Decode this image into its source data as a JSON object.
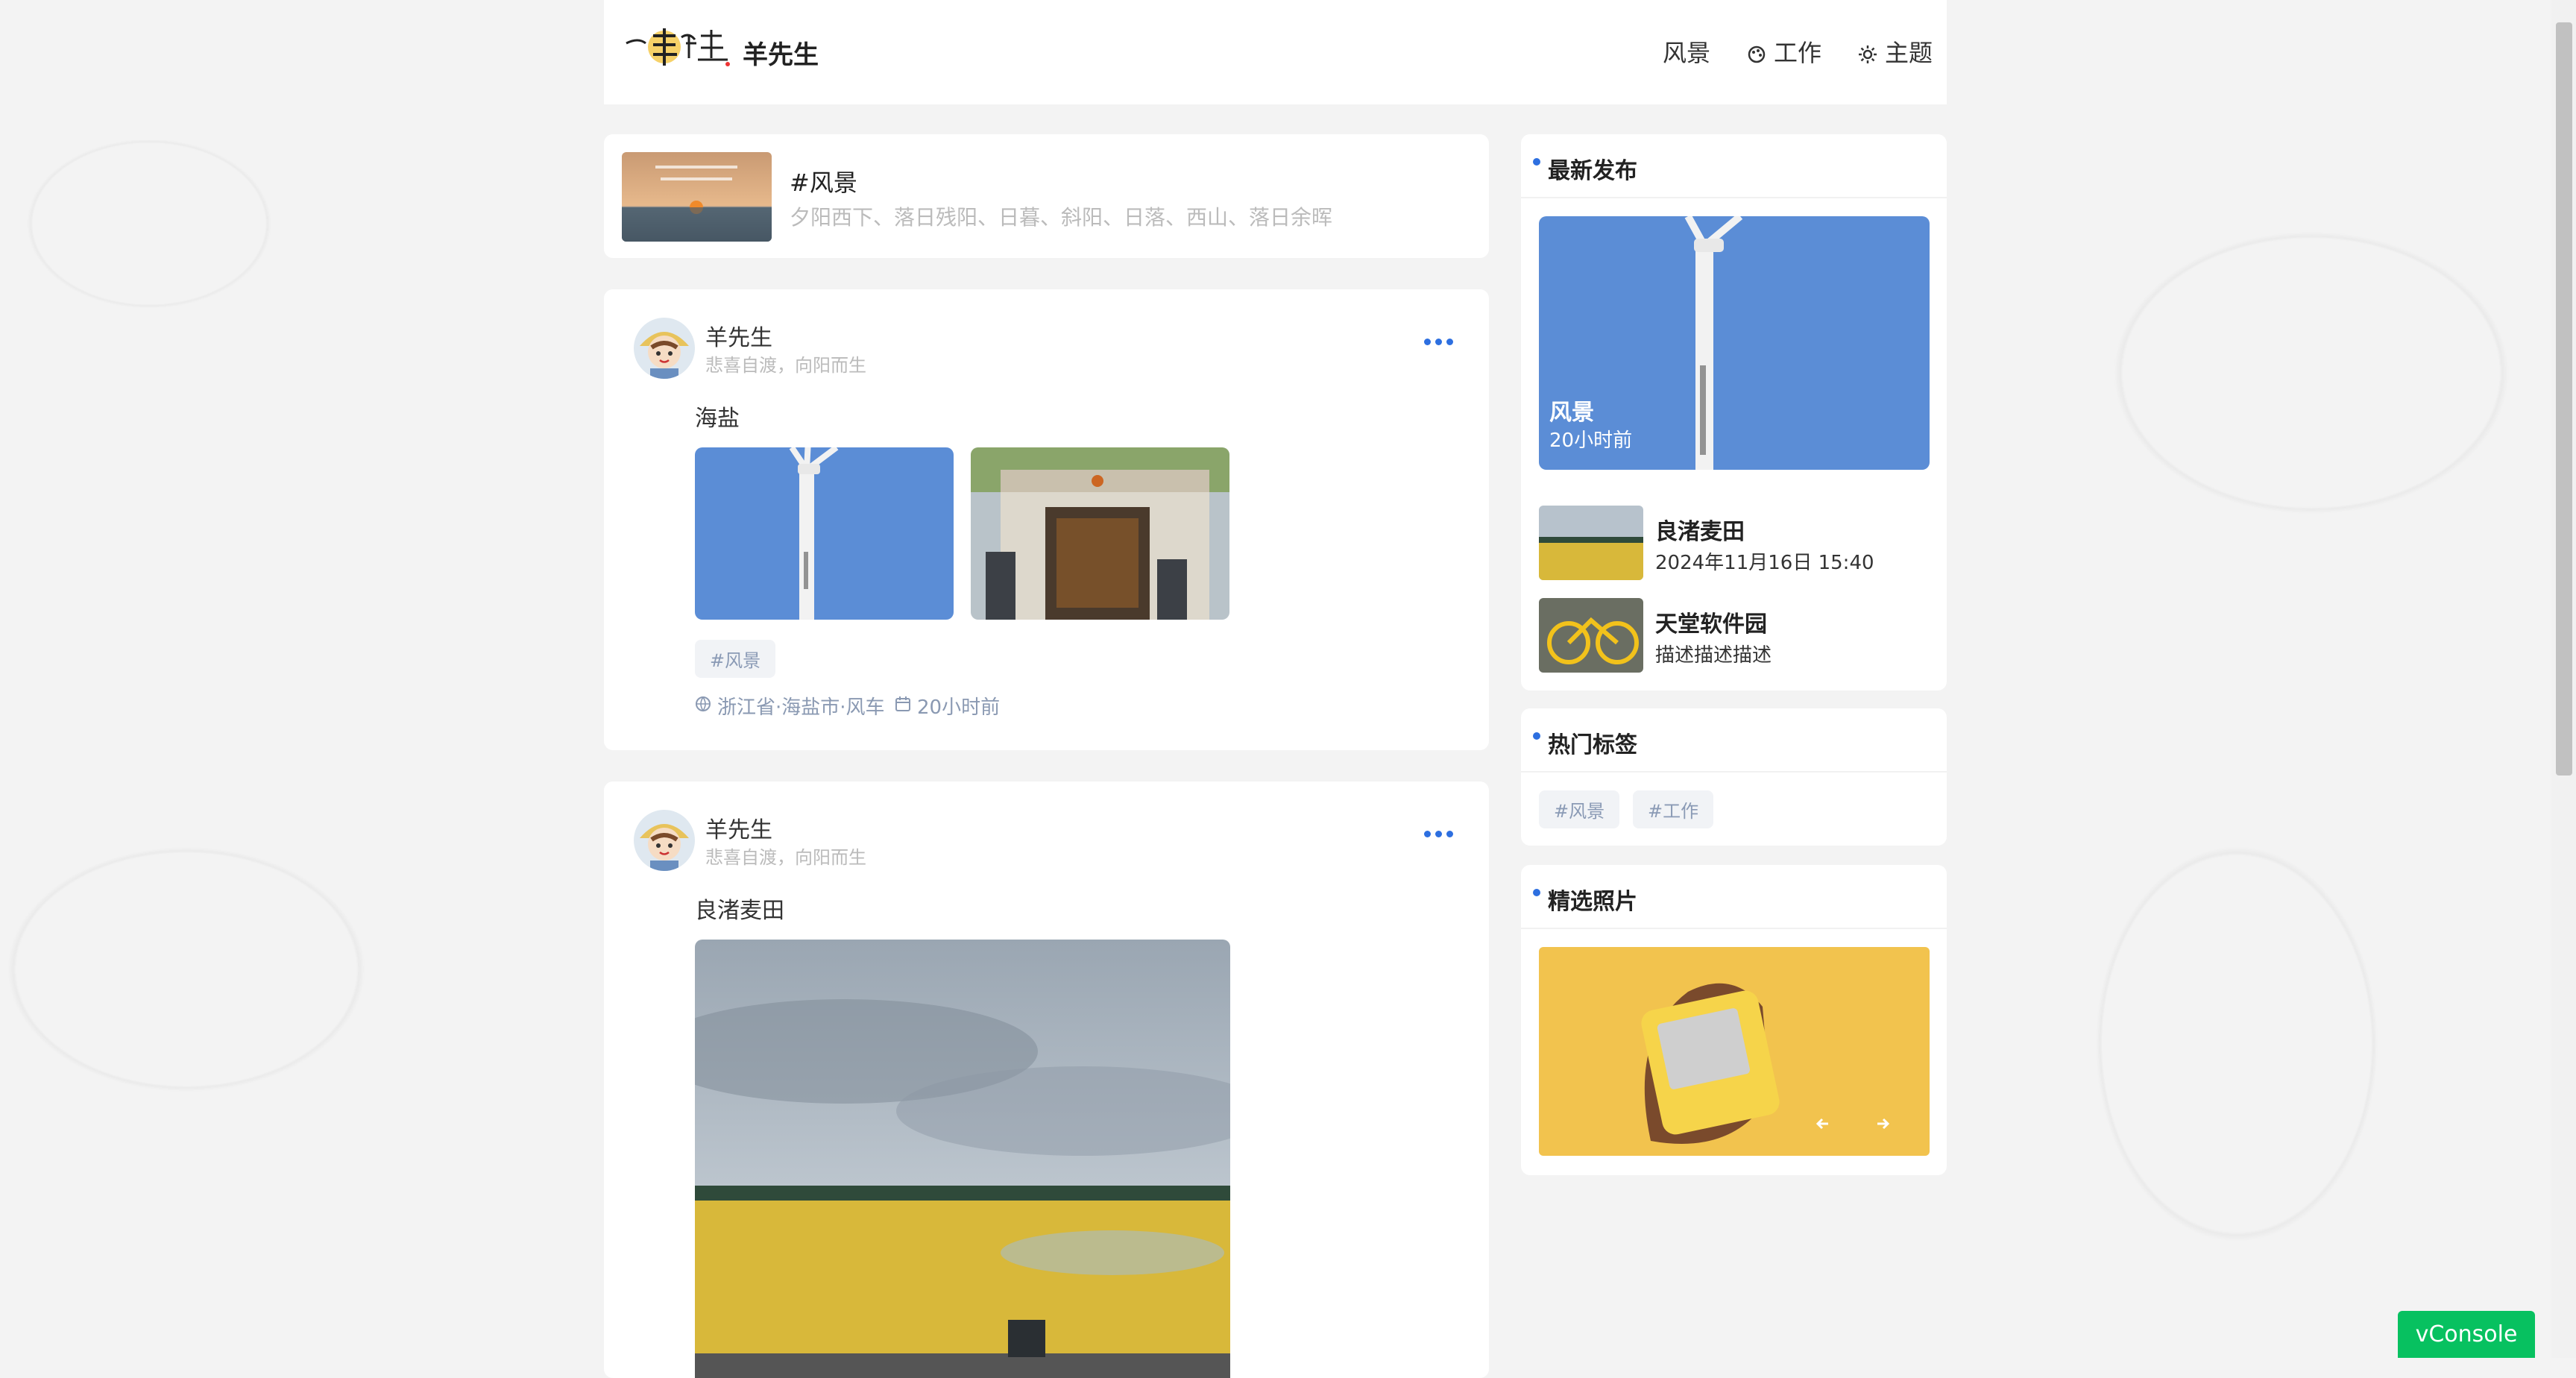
{
  "header": {
    "site_name": "羊先生",
    "nav": [
      {
        "label": "风景",
        "icon": ""
      },
      {
        "label": "工作",
        "icon": "palette-icon"
      },
      {
        "label": "主题",
        "icon": "sun-icon"
      }
    ]
  },
  "topic": {
    "title": "#风景",
    "description": "夕阳西下、落日残阳、日暮、斜阳、日落、西山、落日余晖"
  },
  "posts": [
    {
      "author": "羊先生",
      "bio": "悲喜自渡，向阳而生",
      "text": "海盐",
      "tag": "#风景",
      "location": "浙江省·海盐市·风车",
      "time": "20小时前"
    },
    {
      "author": "羊先生",
      "bio": "悲喜自渡，向阳而生",
      "text": "良渚麦田"
    }
  ],
  "sidebar": {
    "latest": {
      "title": "最新发布",
      "hero": {
        "title": "风景",
        "time": "20小时前"
      },
      "items": [
        {
          "title": "良渚麦田",
          "subtitle": "2024年11月16日 15:40"
        },
        {
          "title": "天堂软件园",
          "subtitle": "描述描述描述"
        }
      ]
    },
    "hot_tags": {
      "title": "热门标签",
      "tags": [
        "#风景",
        "#工作"
      ]
    },
    "featured": {
      "title": "精选照片"
    }
  },
  "vconsole": {
    "label": "vConsole"
  },
  "colors": {
    "accent": "#2d6fe0",
    "vconsole": "#07c160"
  }
}
